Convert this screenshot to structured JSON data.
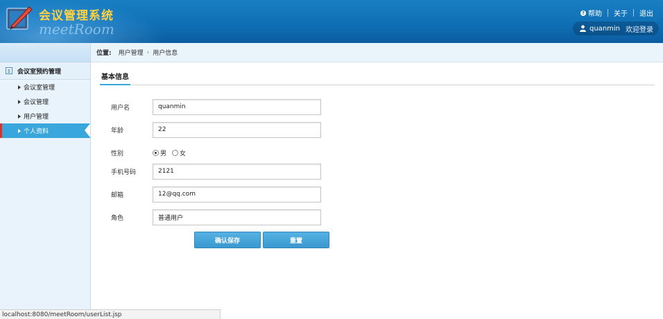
{
  "header": {
    "title": "会议管理系统",
    "subtitle": "meetRoom",
    "links": {
      "help": "帮助",
      "about": "关于",
      "logout": "退出"
    },
    "username": "quanmin",
    "welcome": "欢迎登录"
  },
  "sidebar": {
    "group": "会议室预约管理",
    "items": [
      {
        "label": "会议室管理",
        "active": false
      },
      {
        "label": "会议管理",
        "active": false
      },
      {
        "label": "用户管理",
        "active": false
      },
      {
        "label": "个人资料",
        "active": true
      }
    ]
  },
  "breadcrumb": {
    "prefix": "位置:",
    "items": [
      "用户管理",
      "用户信息"
    ],
    "separator": "›"
  },
  "section": {
    "title": "基本信息"
  },
  "form": {
    "username": {
      "label": "用户名",
      "value": "quanmin"
    },
    "age": {
      "label": "年龄",
      "value": "22"
    },
    "gender": {
      "label": "性别",
      "options": [
        "男",
        "女"
      ],
      "selected": "男"
    },
    "phone": {
      "label": "手机号码",
      "value": "2121"
    },
    "email": {
      "label": "邮箱",
      "value": "12@qq.com"
    },
    "role": {
      "label": "角色",
      "value": "普通用户"
    }
  },
  "buttons": {
    "save": "确认保存",
    "reset": "重置"
  },
  "status_url": "localhost:8080/meetRoom/userList.jsp",
  "colors": {
    "header": "#0f6fb5",
    "title": "#ffd23f",
    "accent": "#3aa7dc",
    "active_marker": "#d9342b"
  }
}
